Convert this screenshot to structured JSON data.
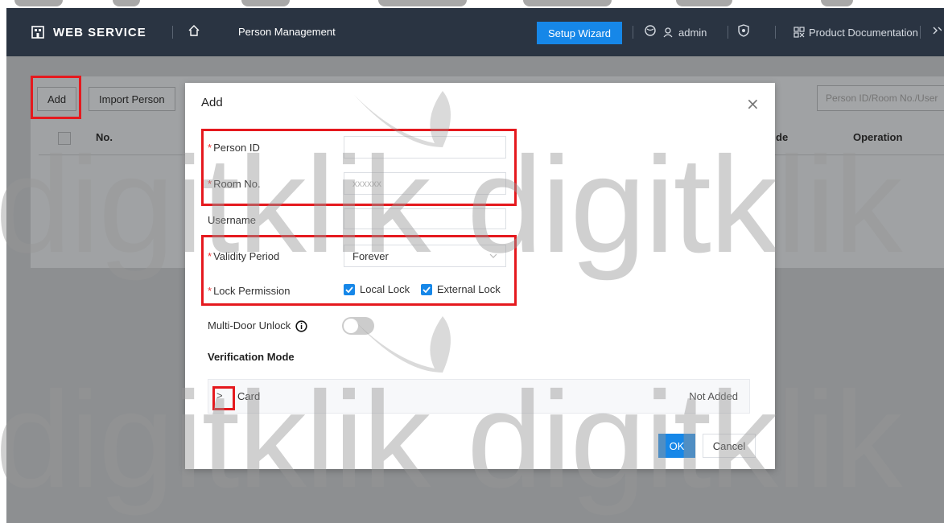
{
  "header": {
    "brand": "WEB SERVICE",
    "title": "Person Management",
    "setup_wizard": "Setup Wizard",
    "user": "admin",
    "product_docs": "Product Documentation"
  },
  "page": {
    "add_button": "Add",
    "import_button": "Import Person",
    "search_placeholder": "Person ID/Room No./User",
    "columns": {
      "no": "No.",
      "mode": "de",
      "operation": "Operation"
    }
  },
  "dialog": {
    "title": "Add",
    "person_id_label": "Person ID",
    "person_id_value": "",
    "room_no_label": "Room No.",
    "room_no_placeholder": "xxxxxx",
    "username_label": "Username",
    "username_value": "",
    "validity_label": "Validity Period",
    "validity_value": "Forever",
    "lock_label": "Lock Permission",
    "local_lock": "Local Lock",
    "external_lock": "External Lock",
    "multi_door_label": "Multi-Door Unlock",
    "verification_title": "Verification Mode",
    "card_label": "Card",
    "card_status": "Not Added",
    "ok": "OK",
    "cancel": "Cancel"
  },
  "watermark": "digitklik",
  "colors": {
    "header_bg": "#2a3442",
    "primary": "#1687e8",
    "highlight": "#e5191e",
    "required": "#e33333"
  }
}
